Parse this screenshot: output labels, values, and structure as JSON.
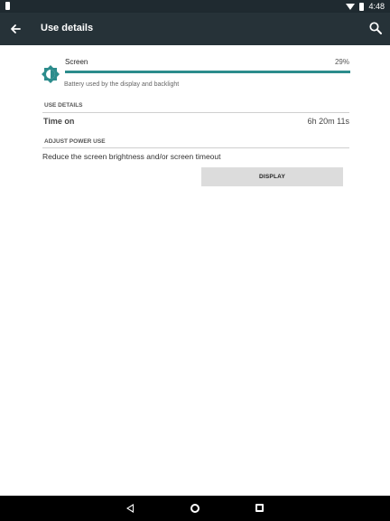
{
  "status_bar": {
    "time": "4:48"
  },
  "header": {
    "title": "Use details"
  },
  "screen": {
    "label": "Screen",
    "percent": "29%",
    "percent_value": 29,
    "description": "Battery used by the display and backlight"
  },
  "use_details": {
    "header": "USE DETAILS",
    "time_on_label": "Time on",
    "time_on_value": "6h 20m 11s"
  },
  "adjust": {
    "header": "ADJUST POWER USE",
    "text": "Reduce the screen brightness and/or screen timeout",
    "button": "DISPLAY"
  },
  "colors": {
    "accent": "#2C8C8C",
    "app_bar": "#263238",
    "status_bar": "#1F2A30"
  }
}
